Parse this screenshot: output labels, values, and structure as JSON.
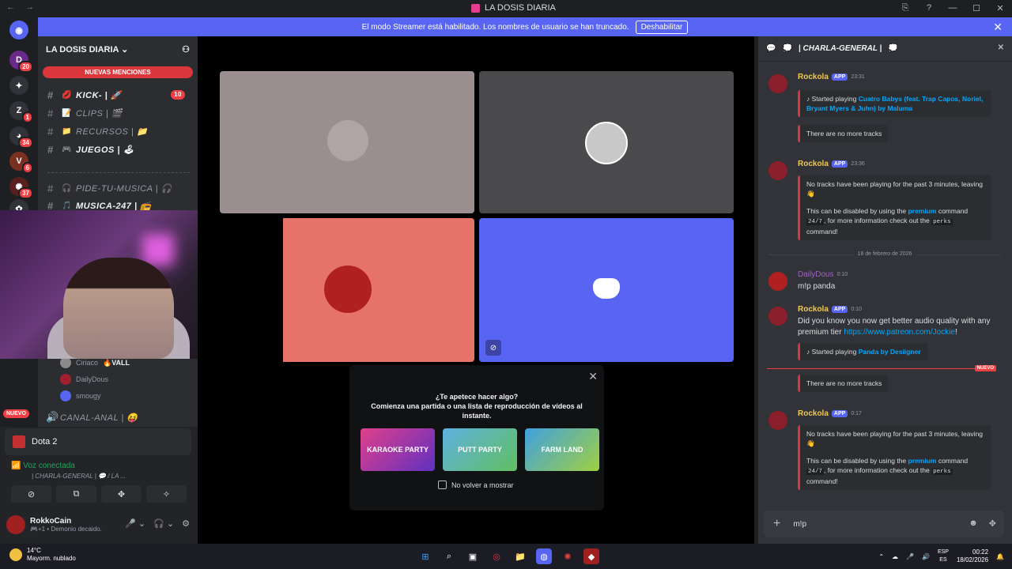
{
  "window": {
    "title": "LA DOSIS DIARIA",
    "back_icon": "←",
    "forward_icon": "→",
    "controls": [
      "⎘",
      "?",
      "—",
      "☐",
      "✕"
    ]
  },
  "banner": {
    "text": "El modo Streamer está habilitado. Los nombres de usuario se han truncado.",
    "button": "Deshabilitar",
    "close": "✕"
  },
  "guilds": [
    {
      "label": "◉",
      "badge": ""
    },
    {
      "label": "D",
      "badge": "20"
    },
    {
      "label": "✦",
      "badge": ""
    },
    {
      "label": "Z",
      "badge": "1"
    },
    {
      "label": "◕",
      "badge": "34"
    },
    {
      "label": "V",
      "badge": "6"
    },
    {
      "label": "✺",
      "badge": "37"
    },
    {
      "label": "✿",
      "badge": ""
    }
  ],
  "server": {
    "name": "LA DOSIS DIARIA ⌄",
    "invite_icon": "⚇",
    "new_mentions": "NUEVAS MENCIONES"
  },
  "channels": [
    {
      "emoji": "💋",
      "name": "KICK- | 🚀",
      "badge": "10",
      "bold": true
    },
    {
      "emoji": "📝",
      "name": "CLIPS | 🎬",
      "badge": "",
      "bold": false
    },
    {
      "emoji": "📁",
      "name": "RECURSOS | 📁",
      "badge": "",
      "bold": false
    },
    {
      "emoji": "🎮",
      "name": "JUEGOS | 🕹",
      "badge": "",
      "bold": true
    },
    {
      "emoji": "🎧",
      "name": "PIDE-TU-MUSICA | 🎧",
      "badge": "",
      "bold": false
    },
    {
      "emoji": "🎵",
      "name": "MUSICA-247 | 📻",
      "badge": "",
      "bold": true
    }
  ],
  "voice_users": [
    {
      "name": "Ciriaco",
      "tag": "🔥VALL"
    },
    {
      "name": "DailyDous",
      "tag": ""
    },
    {
      "name": "smougy",
      "tag": ""
    }
  ],
  "voice_channel": {
    "name": "CANAL-ANAL | 😝",
    "new_label": "NUEVO"
  },
  "game": {
    "name": "Dota 2"
  },
  "voice": {
    "status": "Voz conectada",
    "channel": "| CHARLA-GENERAL | 💬 / LA ..."
  },
  "voice_buttons": [
    "⊘",
    "⧉",
    "✥",
    "✧"
  ],
  "user": {
    "name": "RokkoCain",
    "status": "🎮+1 • Demonio decaido.",
    "controls": [
      "🎤 ⌄",
      "🎧 ⌄",
      "⚙"
    ]
  },
  "activity": {
    "question": "¿Te apetece hacer algo?",
    "subtitle": "Comienza una partida o una lista de reproducción de vídeos al instante.",
    "games": [
      "KARAOKE PARTY",
      "PUTT PARTY",
      "FARM LAND"
    ],
    "checkbox": "No volver a mostrar",
    "close": "✕"
  },
  "chat": {
    "channel": "| CHARLA-GENERAL |",
    "date_separator": "18 de febrero de 2026",
    "new_label": "NUEVO",
    "input_value": "m!p",
    "messages": [
      {
        "author": "Rockola",
        "app": "APP",
        "time": "23:31"
      },
      {
        "author": "Rockola",
        "app": "APP",
        "time": "23:36"
      },
      {
        "author": "DailyDous",
        "app": "",
        "time": "0:10"
      },
      {
        "author": "Rockola",
        "app": "APP",
        "time": "0:10"
      },
      {
        "author": "Rockola",
        "app": "APP",
        "time": "0:17"
      }
    ],
    "texts": {
      "started_playing": "Started playing",
      "song1": "Cuatro Babys (feat. Trap Capos, Noriel, Bryant Myers & Juhn) by Maluma",
      "no_more": "There are no more tracks",
      "idle1": "No tracks have been playing for the past 3 minutes, leaving 👋",
      "idle2a": "This can be disabled by using the",
      "premium": "premium",
      "idle2b": "command",
      "code1": "24/7",
      "idle2c": ", for more information check out the",
      "code2": "perks",
      "idle2d": "command!",
      "user_msg": "m!p panda",
      "promo": "Did you know you now get better audio quality with any premium tier",
      "promo_url": "https://www.patreon.com/Jockie",
      "promo_end": "!",
      "song2": "Panda by Desiigner"
    }
  },
  "taskbar": {
    "temp": "14°C",
    "weather": "Mayorm. nublado",
    "apps": [
      "⊞",
      "⌕",
      "▣",
      "◎",
      "📁",
      "◍",
      "✺",
      "◆"
    ],
    "lang1": "ESP",
    "lang2": "ES",
    "time": "00:22",
    "date": "18/02/2026",
    "tray": [
      "⌃",
      "☁",
      "🎤",
      "🔊"
    ]
  }
}
